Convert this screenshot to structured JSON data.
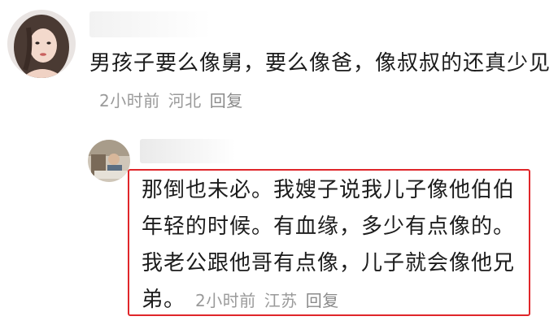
{
  "comments": [
    {
      "text": "男孩子要么像舅，要么像爸，像叔叔的还真少见",
      "time": "2小时前",
      "location": "河北",
      "reply_label": "回复"
    },
    {
      "text": "那倒也未必。我嫂子说我儿子像他伯伯年轻的时候。有血缘，多少有点像的。我老公跟他哥有点像，儿子就会像他兄弟。",
      "time": "2小时前",
      "location": "江苏",
      "reply_label": "回复"
    }
  ],
  "colors": {
    "highlight_border": "#e0262a",
    "meta_text": "#9a9a9a",
    "body_text": "#1c1c1c"
  }
}
